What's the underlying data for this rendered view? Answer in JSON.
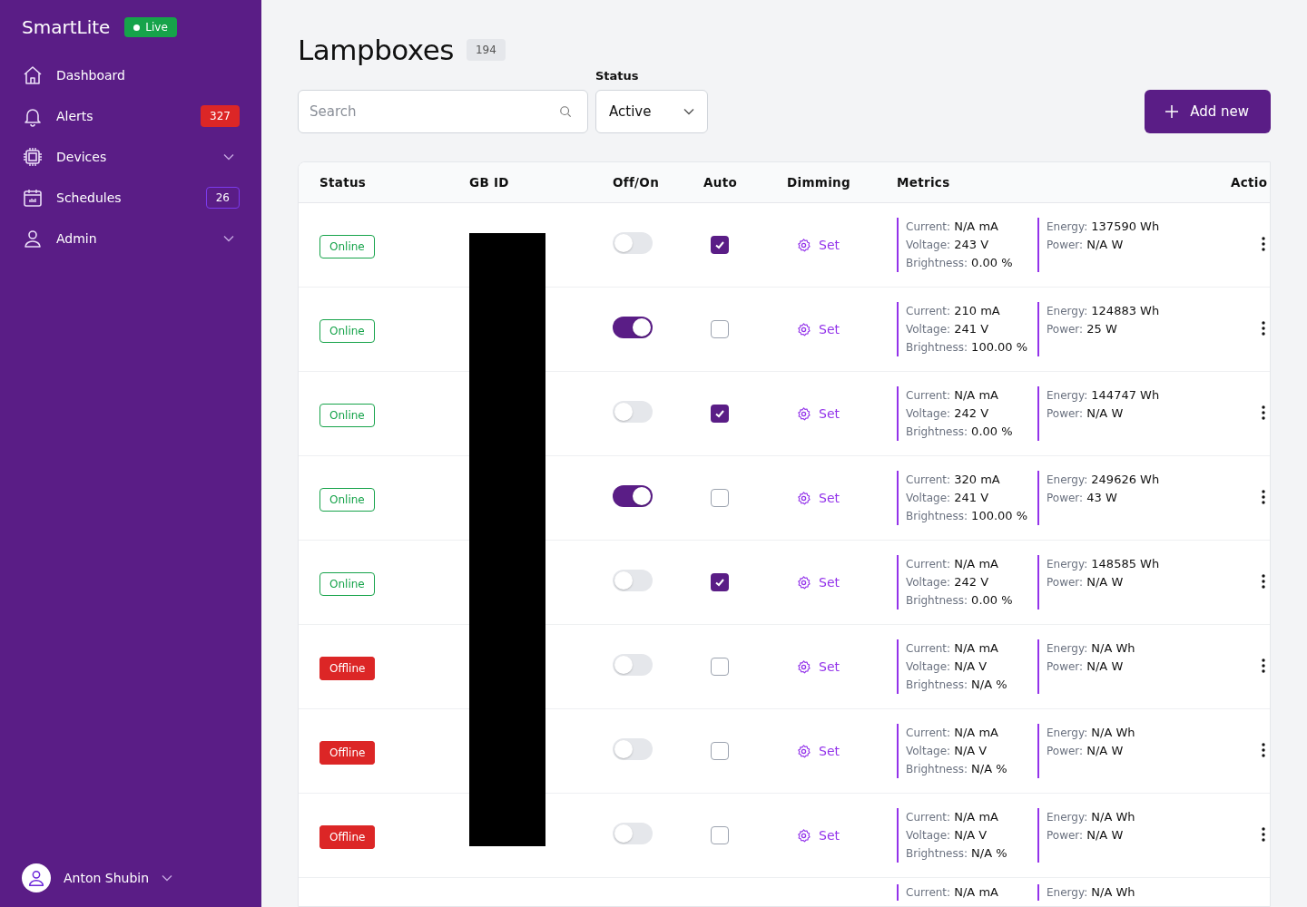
{
  "sidebar": {
    "brand": "SmartLite",
    "live_badge": "Live",
    "items": [
      {
        "label": "Dashboard"
      },
      {
        "label": "Alerts",
        "badge": {
          "text": "327",
          "kind": "alert"
        }
      },
      {
        "label": "Devices",
        "expandable": true
      },
      {
        "label": "Schedules",
        "badge": {
          "text": "26",
          "kind": "outline"
        }
      },
      {
        "label": "Admin",
        "expandable": true
      }
    ],
    "user": {
      "name": "Anton Shubin"
    }
  },
  "page": {
    "title": "Lampboxes",
    "count": "194"
  },
  "filters": {
    "search": {
      "placeholder": "Search"
    },
    "status": {
      "label": "Status",
      "value": "Active"
    },
    "add_button": "Add new"
  },
  "table": {
    "columns": [
      "Status",
      "GB ID",
      "Off/On",
      "Auto",
      "Dimming",
      "Metrics",
      "Actio"
    ],
    "rows": [
      {
        "status": {
          "label": "Online",
          "kind": "online"
        },
        "on": false,
        "auto": true,
        "dimming": "Set",
        "metrics_left": [
          {
            "label": "Current:",
            "value": "N/A mA"
          },
          {
            "label": "Voltage:",
            "value": "243 V"
          },
          {
            "label": "Brightness:",
            "value": "0.00 %"
          }
        ],
        "metrics_right": [
          {
            "label": "Energy:",
            "value": "137590 Wh"
          },
          {
            "label": "Power:",
            "value": "N/A W"
          }
        ]
      },
      {
        "status": {
          "label": "Online",
          "kind": "online"
        },
        "on": true,
        "auto": false,
        "dimming": "Set",
        "metrics_left": [
          {
            "label": "Current:",
            "value": "210 mA"
          },
          {
            "label": "Voltage:",
            "value": "241 V"
          },
          {
            "label": "Brightness:",
            "value": "100.00 %"
          }
        ],
        "metrics_right": [
          {
            "label": "Energy:",
            "value": "124883 Wh"
          },
          {
            "label": "Power:",
            "value": "25 W"
          }
        ]
      },
      {
        "status": {
          "label": "Online",
          "kind": "online"
        },
        "on": false,
        "auto": true,
        "dimming": "Set",
        "metrics_left": [
          {
            "label": "Current:",
            "value": "N/A mA"
          },
          {
            "label": "Voltage:",
            "value": "242 V"
          },
          {
            "label": "Brightness:",
            "value": "0.00 %"
          }
        ],
        "metrics_right": [
          {
            "label": "Energy:",
            "value": "144747 Wh"
          },
          {
            "label": "Power:",
            "value": "N/A W"
          }
        ]
      },
      {
        "status": {
          "label": "Online",
          "kind": "online"
        },
        "on": true,
        "auto": false,
        "dimming": "Set",
        "metrics_left": [
          {
            "label": "Current:",
            "value": "320 mA"
          },
          {
            "label": "Voltage:",
            "value": "241 V"
          },
          {
            "label": "Brightness:",
            "value": "100.00 %"
          }
        ],
        "metrics_right": [
          {
            "label": "Energy:",
            "value": "249626 Wh"
          },
          {
            "label": "Power:",
            "value": "43 W"
          }
        ]
      },
      {
        "status": {
          "label": "Online",
          "kind": "online"
        },
        "on": false,
        "auto": true,
        "dimming": "Set",
        "metrics_left": [
          {
            "label": "Current:",
            "value": "N/A mA"
          },
          {
            "label": "Voltage:",
            "value": "242 V"
          },
          {
            "label": "Brightness:",
            "value": "0.00 %"
          }
        ],
        "metrics_right": [
          {
            "label": "Energy:",
            "value": "148585 Wh"
          },
          {
            "label": "Power:",
            "value": "N/A W"
          }
        ]
      },
      {
        "status": {
          "label": "Offline",
          "kind": "offline"
        },
        "on": false,
        "auto": false,
        "dimming": "Set",
        "metrics_left": [
          {
            "label": "Current:",
            "value": "N/A mA"
          },
          {
            "label": "Voltage:",
            "value": "N/A V"
          },
          {
            "label": "Brightness:",
            "value": "N/A %"
          }
        ],
        "metrics_right": [
          {
            "label": "Energy:",
            "value": "N/A Wh"
          },
          {
            "label": "Power:",
            "value": "N/A W"
          }
        ]
      },
      {
        "status": {
          "label": "Offline",
          "kind": "offline"
        },
        "on": false,
        "auto": false,
        "dimming": "Set",
        "metrics_left": [
          {
            "label": "Current:",
            "value": "N/A mA"
          },
          {
            "label": "Voltage:",
            "value": "N/A V"
          },
          {
            "label": "Brightness:",
            "value": "N/A %"
          }
        ],
        "metrics_right": [
          {
            "label": "Energy:",
            "value": "N/A Wh"
          },
          {
            "label": "Power:",
            "value": "N/A W"
          }
        ]
      },
      {
        "status": {
          "label": "Offline",
          "kind": "offline"
        },
        "on": false,
        "auto": false,
        "dimming": "Set",
        "metrics_left": [
          {
            "label": "Current:",
            "value": "N/A mA"
          },
          {
            "label": "Voltage:",
            "value": "N/A V"
          },
          {
            "label": "Brightness:",
            "value": "N/A %"
          }
        ],
        "metrics_right": [
          {
            "label": "Energy:",
            "value": "N/A Wh"
          },
          {
            "label": "Power:",
            "value": "N/A W"
          }
        ]
      },
      {
        "metrics_left": [
          {
            "label": "Current:",
            "value": "N/A mA"
          }
        ],
        "metrics_right": [
          {
            "label": "Energy:",
            "value": "N/A Wh"
          }
        ]
      }
    ]
  }
}
